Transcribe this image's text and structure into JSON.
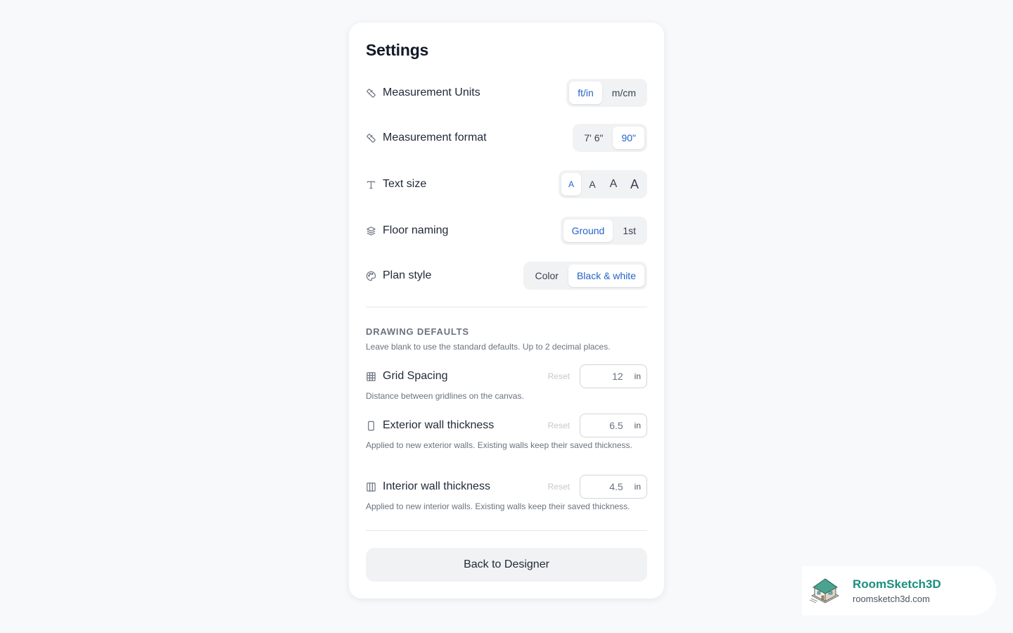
{
  "settings": {
    "title": "Settings",
    "measurement_units": {
      "label": "Measurement Units",
      "options": [
        "ft/in",
        "m/cm"
      ],
      "selected": "ft/in"
    },
    "measurement_format": {
      "label": "Measurement format",
      "options": [
        "7' 6\"",
        "90\""
      ],
      "selected": "90\""
    },
    "text_size": {
      "label": "Text size",
      "options": [
        "A",
        "A",
        "A",
        "A"
      ],
      "selected_index": 0
    },
    "floor_naming": {
      "label": "Floor naming",
      "options": [
        "Ground",
        "1st"
      ],
      "selected": "Ground"
    },
    "plan_style": {
      "label": "Plan style",
      "options": [
        "Color",
        "Black & white"
      ],
      "selected": "Black & white"
    }
  },
  "drawing_defaults": {
    "title": "DRAWING DEFAULTS",
    "subtitle": "Leave blank to use the standard defaults. Up to 2 decimal places.",
    "reset_label": "Reset",
    "fields": [
      {
        "label": "Grid Spacing",
        "placeholder": "12",
        "unit": "in",
        "help": "Distance between gridlines on the canvas."
      },
      {
        "label": "Exterior wall thickness",
        "placeholder": "6.5",
        "unit": "in",
        "help": "Applied to new exterior walls. Existing walls keep their saved thickness."
      },
      {
        "label": "Interior wall thickness",
        "placeholder": "4.5",
        "unit": "in",
        "help": "Applied to new interior walls. Existing walls keep their saved thickness."
      }
    ]
  },
  "back_button": "Back to Designer",
  "brand": {
    "name": "RoomSketch3D",
    "url": "roomsketch3d.com"
  },
  "colors": {
    "accent": "#2563c9",
    "brand": "#1a8f7e",
    "background": "#f8f9fb"
  },
  "icons": [
    "ruler-icon",
    "ruler-icon",
    "text-size-icon",
    "layers-icon",
    "palette-icon",
    "grid-icon",
    "wall-icon",
    "columns-icon"
  ]
}
